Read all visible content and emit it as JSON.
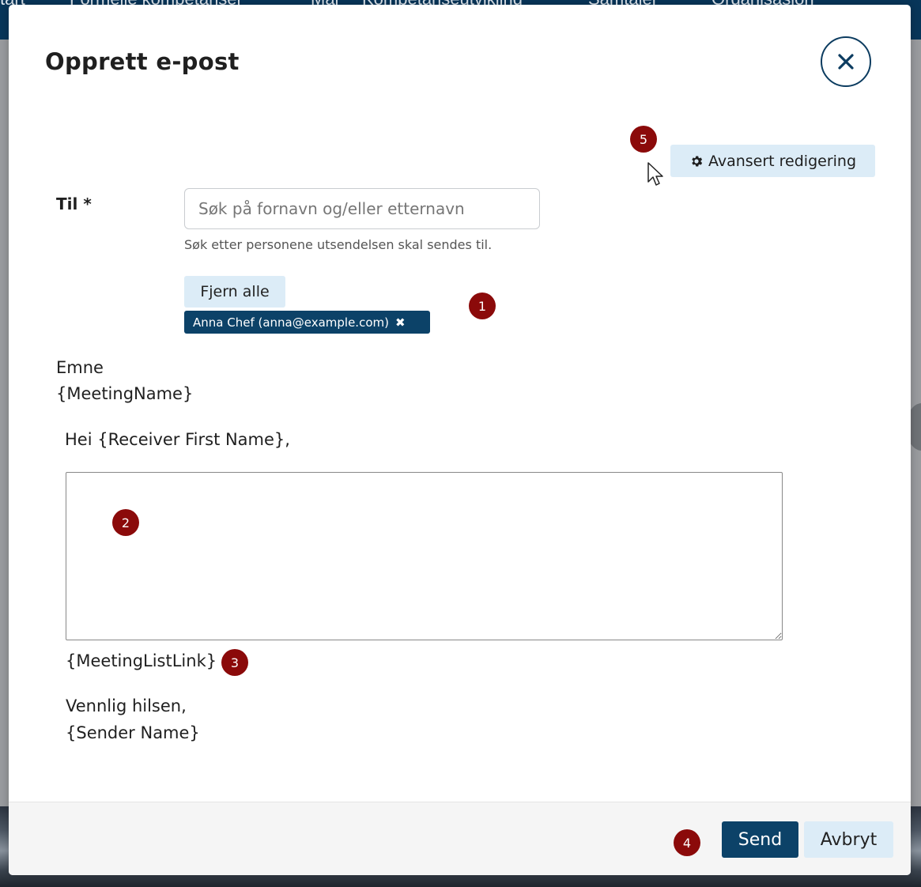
{
  "background": {
    "nav_items": [
      "tart",
      "Formelle kompetanser",
      "Mål",
      "Kompetanseutvikling",
      "Samtaler",
      "Organisasjon"
    ]
  },
  "modal": {
    "title": "Opprett e-post",
    "close_icon": "close-icon",
    "advanced_edit": {
      "label": "Avansert redigering",
      "icon": "gear-icon"
    },
    "to": {
      "label": "Til *",
      "placeholder": "Søk på fornavn og/eller etternavn",
      "value": "",
      "help_text": "Søk etter personene utsendelsen skal sendes til.",
      "remove_all_label": "Fjern alle",
      "recipients": [
        {
          "label": "Anna Chef (anna@example.com)",
          "remove_icon": "✖"
        }
      ]
    },
    "subject": {
      "label": "Emne",
      "value": "{MeetingName}"
    },
    "body": {
      "greeting": "Hei {Receiver First Name},",
      "text": "",
      "link_token": "{MeetingListLink}",
      "sign_off": "Vennlig hilsen,",
      "sender_token": "{Sender Name}"
    },
    "footer": {
      "send_label": "Send",
      "cancel_label": "Avbryt"
    }
  },
  "annotations": {
    "badge_1": "1",
    "badge_2": "2",
    "badge_3": "3",
    "badge_4": "4",
    "badge_5": "5",
    "color": "#8b0a0a"
  },
  "colors": {
    "primary": "#0c4268",
    "secondary_button": "#dcecf7",
    "nav_bar": "#08365a"
  }
}
